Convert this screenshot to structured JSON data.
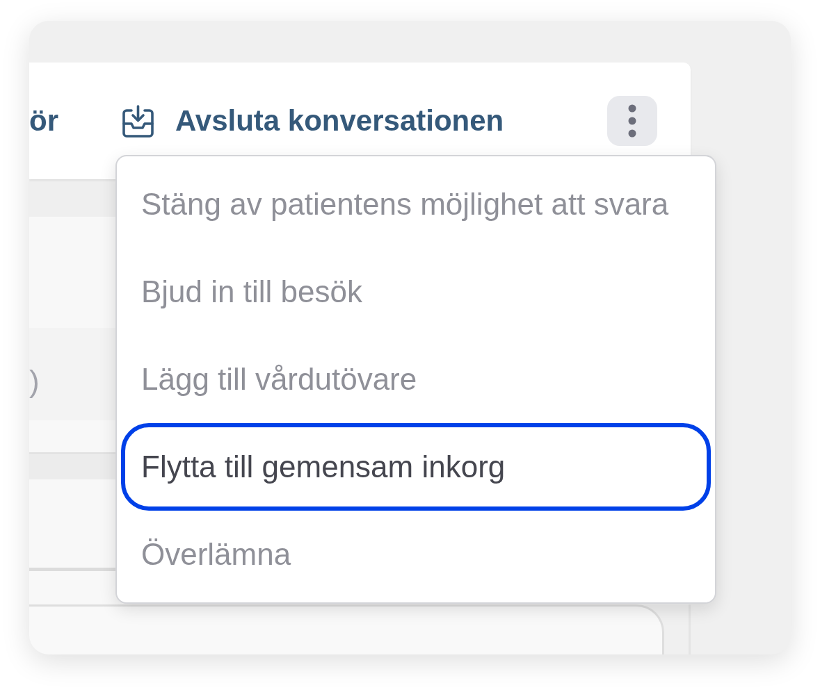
{
  "header": {
    "left_label": "ör",
    "actions": [
      {
        "kind": "tray-download",
        "label": "Avsluta konversationen"
      }
    ],
    "more_button": {
      "expanded": true
    }
  },
  "content": {
    "row_text": ")"
  },
  "menu": {
    "items": [
      {
        "label": "Stäng av patientens möjlighet att svara",
        "focused": false
      },
      {
        "label": "Bjud in till besök",
        "focused": false
      },
      {
        "label": "Lägg till vårdutövare",
        "focused": false
      },
      {
        "label": "Flytta till gemensam inkorg",
        "focused": true
      },
      {
        "label": "Överlämna",
        "focused": false
      }
    ]
  }
}
